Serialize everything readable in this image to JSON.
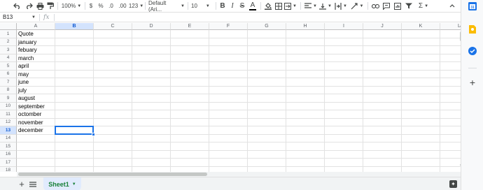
{
  "toolbar": {
    "zoom": "100%",
    "currency": "$",
    "percent": "%",
    "decrease_decimal": ".0",
    "increase_decimal": ".00",
    "number_format": "123",
    "font_family": "Default (Ari...",
    "font_size": "10",
    "bold": "B",
    "italic": "I",
    "strikethrough": "S",
    "text_color": "A",
    "functions": "Σ"
  },
  "formula_bar": {
    "name_box": "B13",
    "fx": "fx",
    "content": ""
  },
  "grid": {
    "columns": [
      "A",
      "B",
      "C",
      "D",
      "E",
      "F",
      "G",
      "H",
      "I",
      "J",
      "K",
      "L"
    ],
    "rows": [
      "1",
      "2",
      "3",
      "4",
      "5",
      "6",
      "7",
      "8",
      "9",
      "10",
      "11",
      "12",
      "13",
      "14",
      "15",
      "16",
      "17",
      "18"
    ],
    "column_a": [
      "Quote",
      "january",
      "febuary",
      "march",
      "april",
      "may",
      "june",
      "july",
      "august",
      "september",
      "octomber",
      "november",
      "december"
    ],
    "selected_cell": "B13"
  },
  "sheets": {
    "tabs": [
      "Sheet1"
    ],
    "active": "Sheet1"
  },
  "colors": {
    "selection": "#1a73e8",
    "sheet_tab_text": "#188038"
  }
}
